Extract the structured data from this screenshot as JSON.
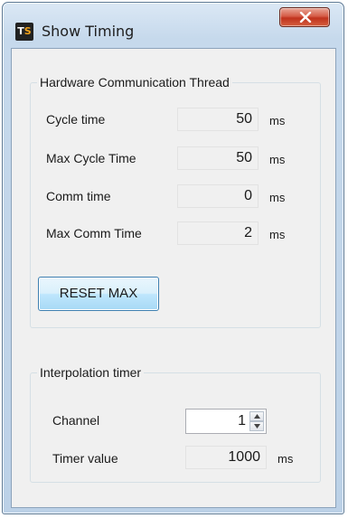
{
  "window": {
    "title": "Show Timing",
    "icon_text_left": "T",
    "icon_text_right": "S"
  },
  "hardware_group": {
    "title": "Hardware Communication Thread",
    "rows": [
      {
        "label": "Cycle time",
        "value": "50",
        "unit": "ms"
      },
      {
        "label": "Max Cycle Time",
        "value": "50",
        "unit": "ms"
      },
      {
        "label": "Comm time",
        "value": "0",
        "unit": "ms"
      },
      {
        "label": "Max Comm Time",
        "value": "2",
        "unit": "ms"
      }
    ],
    "reset_label": "RESET MAX"
  },
  "interpolation_group": {
    "title": "Interpolation timer",
    "channel_label": "Channel",
    "channel_value": "1",
    "timer_label": "Timer value",
    "timer_value": "1000",
    "timer_unit": "ms"
  },
  "colors": {
    "close_button": "#c0321d",
    "reset_button_border": "#3c7fb1",
    "client_background": "#f0f0f0"
  },
  "icons": [
    "app-icon",
    "close-icon",
    "spin-up-icon",
    "spin-down-icon"
  ]
}
